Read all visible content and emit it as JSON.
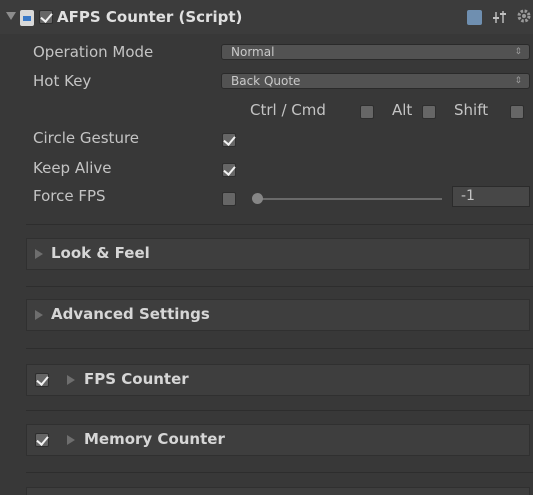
{
  "component": {
    "title": "AFPS Counter (Script)",
    "enabled": true,
    "expanded": true,
    "header_icons": [
      "book-help-icon",
      "preset-sliders-icon",
      "gear-icon"
    ]
  },
  "fields": {
    "operation_mode": {
      "label": "Operation Mode",
      "value": "Normal"
    },
    "hot_key": {
      "label": "Hot Key",
      "value": "Back Quote"
    },
    "modifiers": {
      "ctrl_cmd": {
        "label": "Ctrl / Cmd",
        "checked": false
      },
      "alt": {
        "label": "Alt",
        "checked": false
      },
      "shift": {
        "label": "Shift",
        "checked": false
      }
    },
    "circle_gesture": {
      "label": "Circle Gesture",
      "checked": true
    },
    "keep_alive": {
      "label": "Keep Alive",
      "checked": true
    },
    "force_fps": {
      "label": "Force FPS",
      "checked": false,
      "value": "-1"
    }
  },
  "sections": [
    {
      "title": "Look & Feel",
      "has_checkbox": false,
      "expanded": false
    },
    {
      "title": "Advanced Settings",
      "has_checkbox": false,
      "expanded": false
    },
    {
      "title": "FPS Counter",
      "has_checkbox": true,
      "checked": true,
      "expanded": false
    },
    {
      "title": "Memory Counter",
      "has_checkbox": true,
      "checked": true,
      "expanded": false
    }
  ],
  "colors": {
    "background": "#383838",
    "field": "#525252",
    "text": "#c4c4c4",
    "checkbox": "#666666",
    "checkmark": "#f2f2f2"
  }
}
